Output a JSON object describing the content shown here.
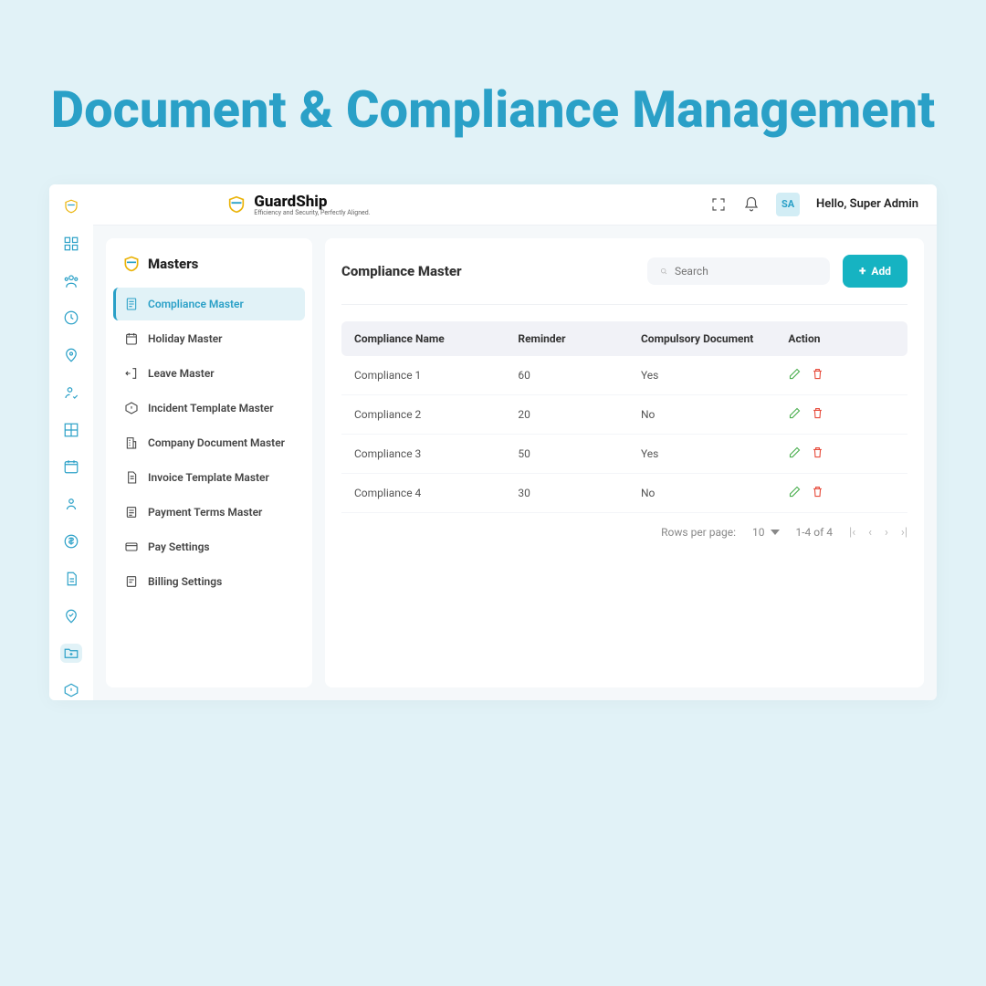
{
  "hero": "Document & Compliance Management",
  "brand": {
    "name": "GuardShip",
    "tagline": "Efficiency and Security, Perfectly Aligned."
  },
  "topbar": {
    "avatar_initials": "SA",
    "greeting": "Hello, Super Admin"
  },
  "sidebar": {
    "title": "Masters",
    "items": [
      {
        "label": "Compliance Master",
        "active": true
      },
      {
        "label": "Holiday Master"
      },
      {
        "label": "Leave Master"
      },
      {
        "label": "Incident Template Master"
      },
      {
        "label": "Company Document Master"
      },
      {
        "label": "Invoice Template Master"
      },
      {
        "label": "Payment Terms Master"
      },
      {
        "label": "Pay Settings"
      },
      {
        "label": "Billing Settings"
      }
    ]
  },
  "panel": {
    "title": "Compliance Master",
    "search_placeholder": "Search",
    "add_label": "Add"
  },
  "table": {
    "headers": {
      "name": "Compliance Name",
      "reminder": "Reminder",
      "doc": "Compulsory Document",
      "action": "Action"
    },
    "rows": [
      {
        "name": "Compliance 1",
        "reminder": "60",
        "doc": "Yes"
      },
      {
        "name": "Compliance 2",
        "reminder": "20",
        "doc": "No"
      },
      {
        "name": "Compliance 3",
        "reminder": "50",
        "doc": "Yes"
      },
      {
        "name": "Compliance 4",
        "reminder": "30",
        "doc": "No"
      }
    ]
  },
  "pager": {
    "rows_label": "Rows per page:",
    "per_page": "10",
    "range": "1-4 of 4"
  }
}
